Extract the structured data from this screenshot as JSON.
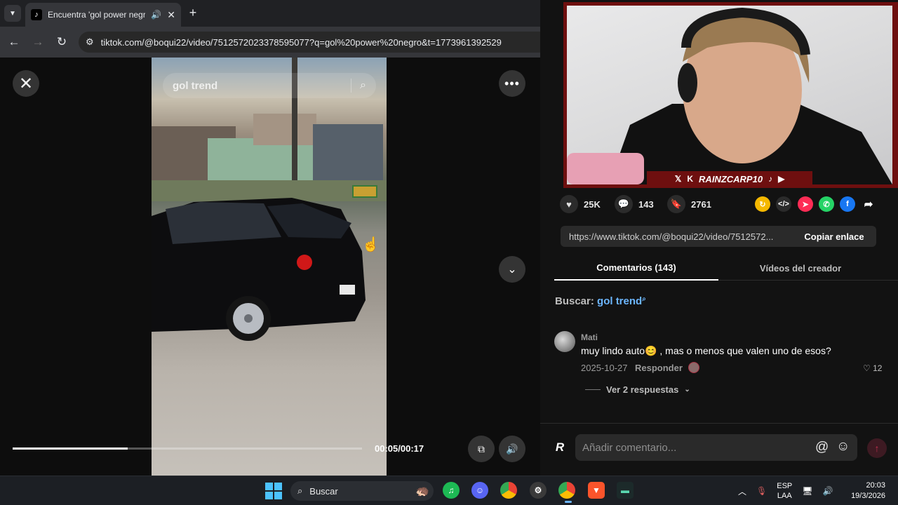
{
  "browser": {
    "tab_title": "Encuentra 'gol power negro'",
    "url": "tiktok.com/@boqui22/video/7512572023378595077?q=gol%20power%20negro&t=1773961392529"
  },
  "video": {
    "search_query": "gol trend",
    "time": "00:05/00:17",
    "progress": 0.33
  },
  "webcam": {
    "banner_text": "RAINZCARP10"
  },
  "stats": {
    "likes": "25K",
    "comments": "143",
    "saves": "2761"
  },
  "link": {
    "url": "https://www.tiktok.com/@boqui22/video/7512572...",
    "copy_label": "Copiar enlace"
  },
  "tabs": {
    "comments": "Comentarios (143)",
    "creator_videos": "Vídeos del creador"
  },
  "search": {
    "label": "Buscar:",
    "keyword": "gol trend"
  },
  "comment": {
    "user": "Mati",
    "text": "muy lindo auto😊 , mas o menos que valen uno de esos?",
    "date": "2025-10-27",
    "reply_label": "Responder",
    "likes": "12",
    "view_replies": "Ver 2 respuestas"
  },
  "composer": {
    "placeholder": "Añadir comentario..."
  },
  "taskbar": {
    "search_label": "Buscar",
    "lang_line1": "ESP",
    "lang_line2": "LAA",
    "time": "20:03",
    "date": "19/3/2026"
  },
  "colors": {
    "accent_link": "#6cb6ff",
    "webcam_frame": "#6e0f0f",
    "send_button": "#c03050"
  }
}
